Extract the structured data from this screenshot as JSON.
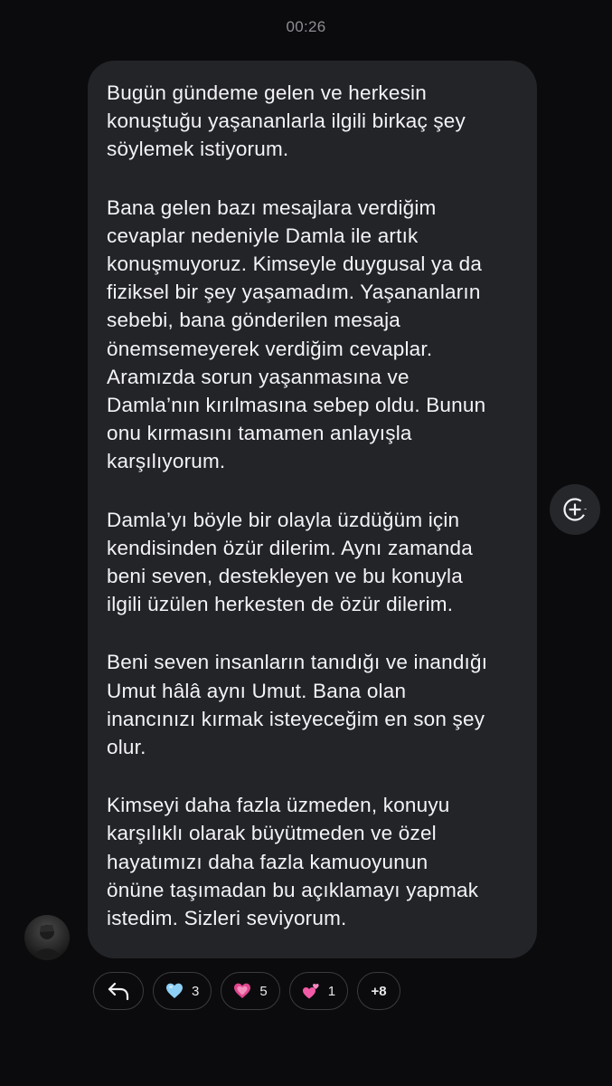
{
  "header": {
    "time": "00:26"
  },
  "message": {
    "paragraphs": [
      "Bugün gündeme gelen ve herkesin\nkonuştuğu yaşananlarla ilgili birkaç şey\nsöylemek istiyorum.",
      "Bana gelen bazı mesajlara verdiğim\ncevaplar nedeniyle Damla ile artık\nkonuşmuyoruz. Kimseyle duygusal ya da\nfiziksel bir şey yaşamadım. Yaşananların\nsebebi, bana gönderilen mesaja\nönemsemeyerek verdiğim cevaplar.\nAramızda sorun yaşanmasına ve\nDamla’nın kırılmasına sebep oldu. Bunun\nonu kırmasını tamamen anlayışla\nkarşılıyorum.",
      "Damla’yı böyle bir olayla üzdüğüm için\nkendisinden özür dilerim. Aynı zamanda\nbeni seven, destekleyen ve bu konuyla\nilgili üzülen herkesten de özür dilerim.",
      "Beni seven insanların tanıdığı ve inandığı\nUmut hâlâ aynı Umut. Bana olan\ninancınızı kırmak isteyeceğim en son şey\nolur.",
      "Kimseyi daha fazla üzmeden, konuyu\nkarşılıklı olarak büyütmeden ve özel\nhayatımızı daha fazla kamuoyunun\nönüne taşımadan bu açıklamayı yapmak\nistedim. Sizleri seviyorum."
    ]
  },
  "side_action": {
    "icon": "add-reaction-icon"
  },
  "reactions": {
    "reply_icon": "reply-arrow-icon",
    "items": [
      {
        "icon": "light-blue-heart-icon",
        "count": "3",
        "color": "#8ecff6"
      },
      {
        "icon": "growing-pink-heart-icon",
        "count": "5",
        "color": "#e0458f"
      },
      {
        "icon": "two-hearts-icon",
        "count": "1",
        "color": "#f05aa6"
      }
    ],
    "more": "+8"
  }
}
